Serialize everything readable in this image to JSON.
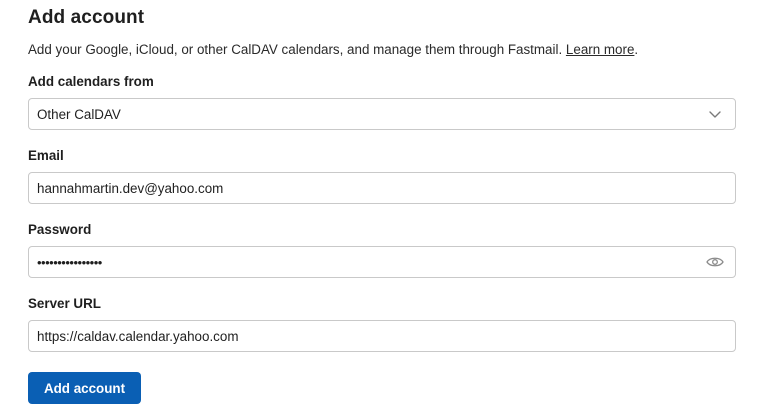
{
  "header": {
    "title": "Add account",
    "description": "Add your Google, iCloud, or other CalDAV calendars, and manage them through Fastmail.",
    "learn_more": "Learn more",
    "trailing_period": "."
  },
  "source": {
    "label": "Add calendars from",
    "selected": "Other CalDAV",
    "icon": "chevron-down-icon"
  },
  "email": {
    "label": "Email",
    "value": "hannahmartin.dev@yahoo.com"
  },
  "password": {
    "label": "Password",
    "value": "••••••••••••••••",
    "icon": "eye-icon"
  },
  "server": {
    "label": "Server URL",
    "value": "https://caldav.calendar.yahoo.com"
  },
  "actions": {
    "submit_label": "Add account"
  },
  "colors": {
    "primary": "#0a5fb4",
    "border": "#c9c9c9",
    "text": "#1f1f1f"
  }
}
